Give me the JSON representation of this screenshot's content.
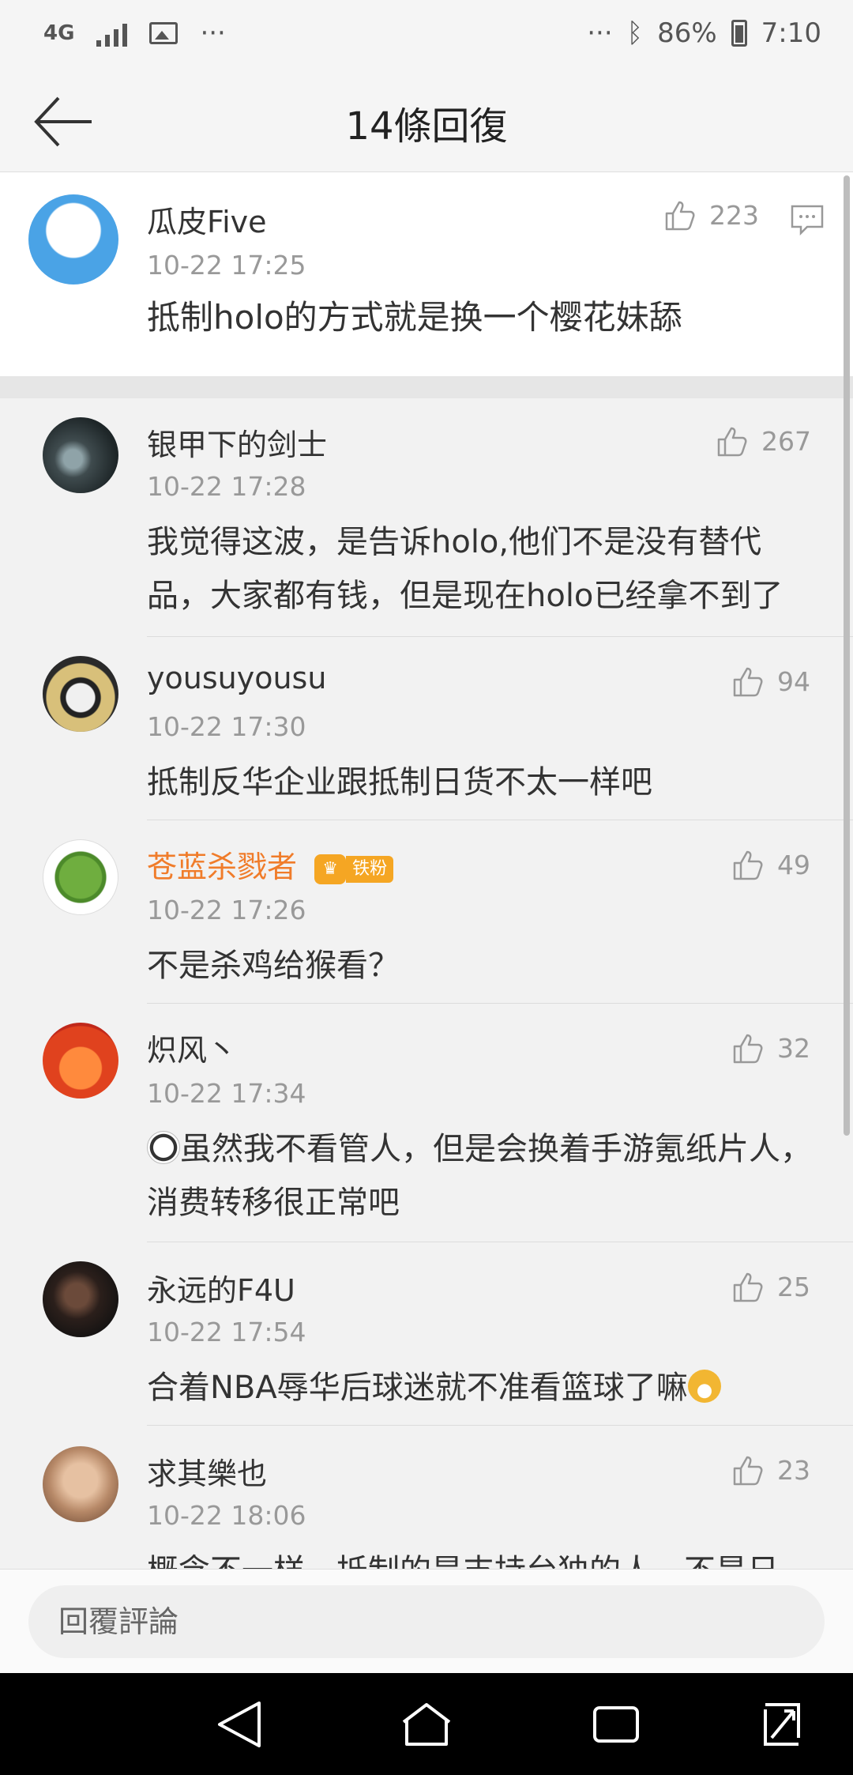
{
  "status_bar": {
    "network": "4G",
    "more": "···",
    "right_more": "···",
    "battery": "86%",
    "time": "7:10"
  },
  "header": {
    "title": "14條回復",
    "back_icon": "arrow-left-icon"
  },
  "main_comment": {
    "username": "瓜皮Five",
    "time": "10-22 17:25",
    "text": "抵制holo的方式就是换一个樱花妹舔",
    "likes": "223"
  },
  "replies": [
    {
      "username": "银甲下的剑士",
      "time": "10-22 17:28",
      "text": "我觉得这波，是告诉holo,他们不是没有替代品，大家都有钱，但是现在holo已经拿不到了",
      "likes": "267"
    },
    {
      "username": "yousuyousu",
      "time": "10-22 17:30",
      "text": "抵制反华企业跟抵制日货不太一样吧",
      "likes": "94"
    },
    {
      "username": "苍蓝杀戮者",
      "badge": "铁粉",
      "time": "10-22 17:26",
      "text": "不是杀鸡给猴看？",
      "likes": "49"
    },
    {
      "username": "炽风丶",
      "time": "10-22 17:34",
      "text": "虽然我不看管人，但是会换着手游氪纸片人，消费转移很正常吧",
      "likes": "32"
    },
    {
      "username": "永远的F4U",
      "time": "10-22 17:54",
      "text": "合着NBA辱华后球迷就不准看篮球了嘛",
      "likes": "25"
    },
    {
      "username": "求其樂也",
      "time": "10-22 18:06",
      "text": "概念不一样，抵制的是支持台独的人，不是日",
      "likes": "23"
    }
  ],
  "input": {
    "placeholder": "回覆評論"
  },
  "colors": {
    "accent_orange": "#f07c2a",
    "badge_gold": "#f5a623",
    "text_gray": "#999999"
  }
}
